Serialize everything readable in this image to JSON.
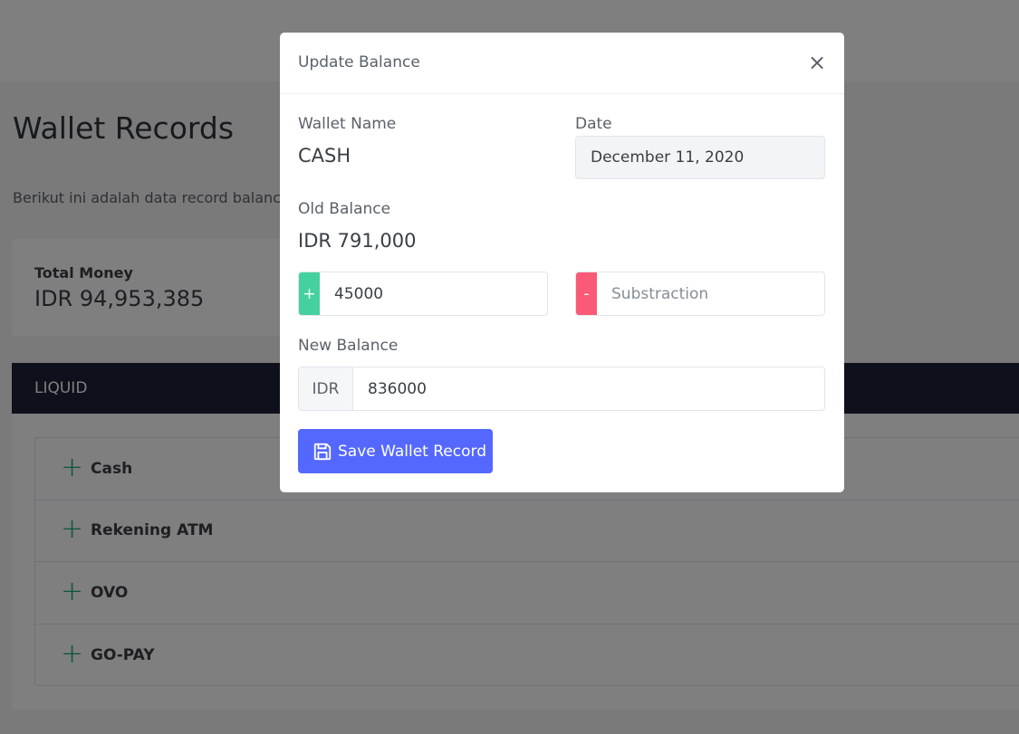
{
  "page": {
    "title": "Wallet Records",
    "description": "Berikut ini adalah data record balance",
    "total": {
      "label": "Total Money",
      "value": "IDR 94,953,385"
    },
    "section": {
      "title": "LIQUID",
      "wallets": [
        {
          "name": "Cash"
        },
        {
          "name": "Rekening ATM"
        },
        {
          "name": "OVO"
        },
        {
          "name": "GO-PAY"
        }
      ]
    }
  },
  "modal": {
    "title": "Update Balance",
    "close_glyph": "×",
    "wallet_name_label": "Wallet Name",
    "wallet_name_value": "CASH",
    "date_label": "Date",
    "date_value": "December 11, 2020",
    "old_balance_label": "Old Balance",
    "old_balance_value": "IDR 791,000",
    "addition": {
      "addon": "+",
      "value": "45000"
    },
    "subtraction": {
      "addon": "-",
      "value": "",
      "placeholder": "Substraction"
    },
    "new_balance_label": "New Balance",
    "new_balance": {
      "currency": "IDR",
      "value": "836000"
    },
    "save_label": "Save Wallet Record"
  },
  "colors": {
    "accent": "#5468ff",
    "add": "#45d19e",
    "subtract": "#fa5a76",
    "section_header": "#1c2136"
  },
  "icons": {
    "wallet_expand": "plus-icon",
    "save": "floppy-disk-icon",
    "close": "close-icon"
  }
}
